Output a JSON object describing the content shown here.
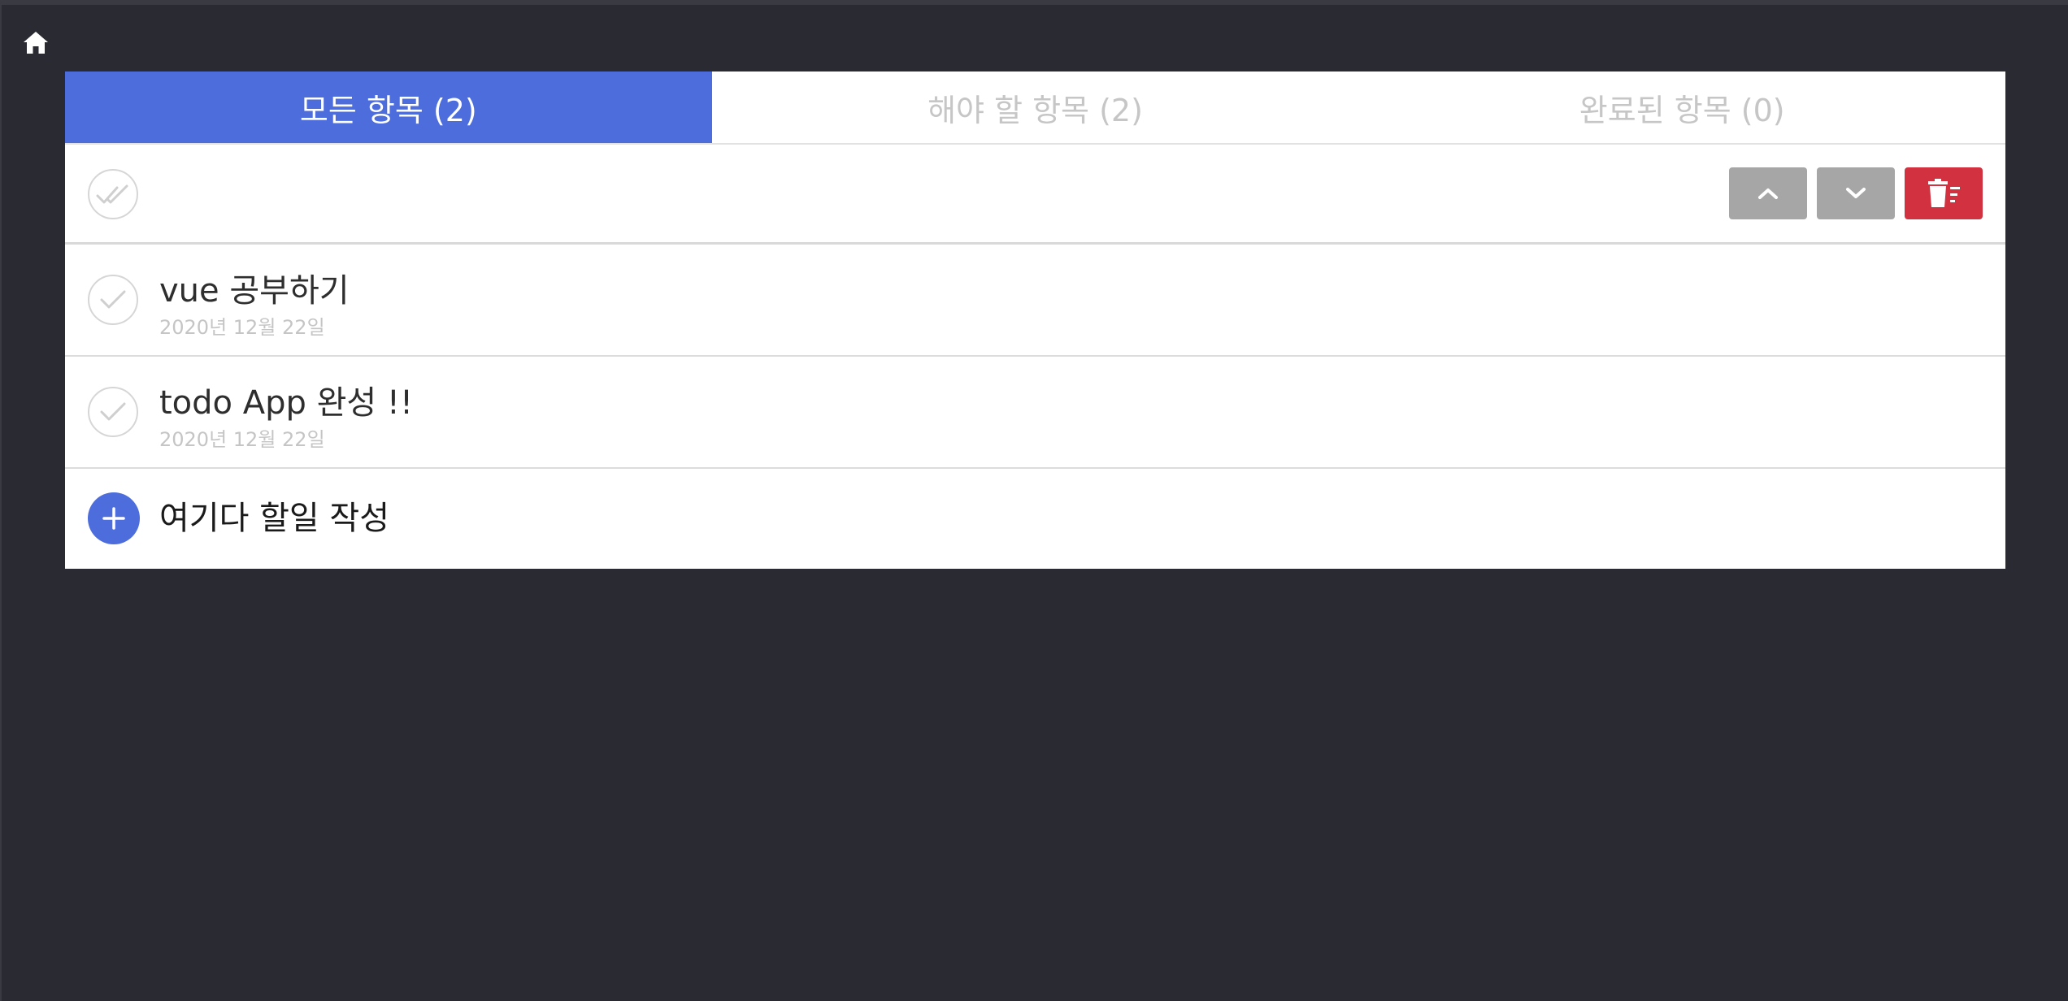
{
  "nav": {
    "home_icon": "home-icon"
  },
  "tabs": [
    {
      "label": "모든 항목 (2)",
      "active": true
    },
    {
      "label": "해야 할 항목 (2)",
      "active": false
    },
    {
      "label": "완료된 항목 (0)",
      "active": false
    }
  ],
  "toolbar": {
    "toggle_all_icon": "double-check-icon",
    "move_up_icon": "chevron-up-icon",
    "move_down_icon": "chevron-down-icon",
    "delete_icon": "trash-icon"
  },
  "todos": [
    {
      "title": "vue 공부하기",
      "date": "2020년 12월 22일",
      "done": false
    },
    {
      "title": "todo App 완성 !!",
      "date": "2020년 12월 22일",
      "done": false
    }
  ],
  "add": {
    "placeholder": "여기다 할일 작성",
    "icon": "plus-icon"
  },
  "colors": {
    "background": "#2a2a33",
    "accent": "#4c6ddb",
    "danger": "#d2313f",
    "neutral_button": "#a6a6a6"
  }
}
